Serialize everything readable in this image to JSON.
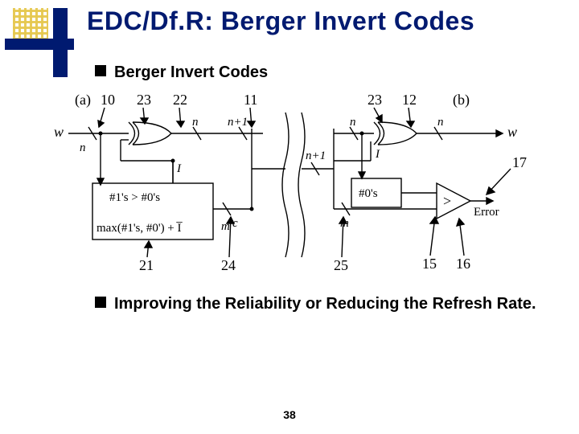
{
  "title": "EDC/Df.R: Berger Invert Codes",
  "bullets": {
    "b1": "Berger Invert Codes",
    "b2": "Improving the Reliability or Reducing the Refresh Rate."
  },
  "page_number": "38",
  "diagram": {
    "a_label": "(a)",
    "b_label": "(b)",
    "w_in": "w",
    "w_out": "w",
    "n": "n",
    "n1": "n",
    "n2": "n",
    "np1": "n+1",
    "np1_b": "n+1",
    "I_a": "I",
    "I_b": "I",
    "c": "c",
    "m_a": "m",
    "m_b": "m",
    "error": "Error",
    "block_count1_line1": "#1's > #0's",
    "block_count1_line2": "max(#1's, #0') + I̅",
    "block_count0": "#0's",
    "cmp": ">",
    "top_labels": {
      "t10": "10",
      "t23a": "23",
      "t22": "22",
      "t11": "11",
      "t23b": "23",
      "t12": "12"
    },
    "num_17": "17",
    "bot_labels": {
      "b21": "21",
      "b24": "24",
      "b25": "25",
      "b15": "15",
      "b16": "16"
    }
  }
}
